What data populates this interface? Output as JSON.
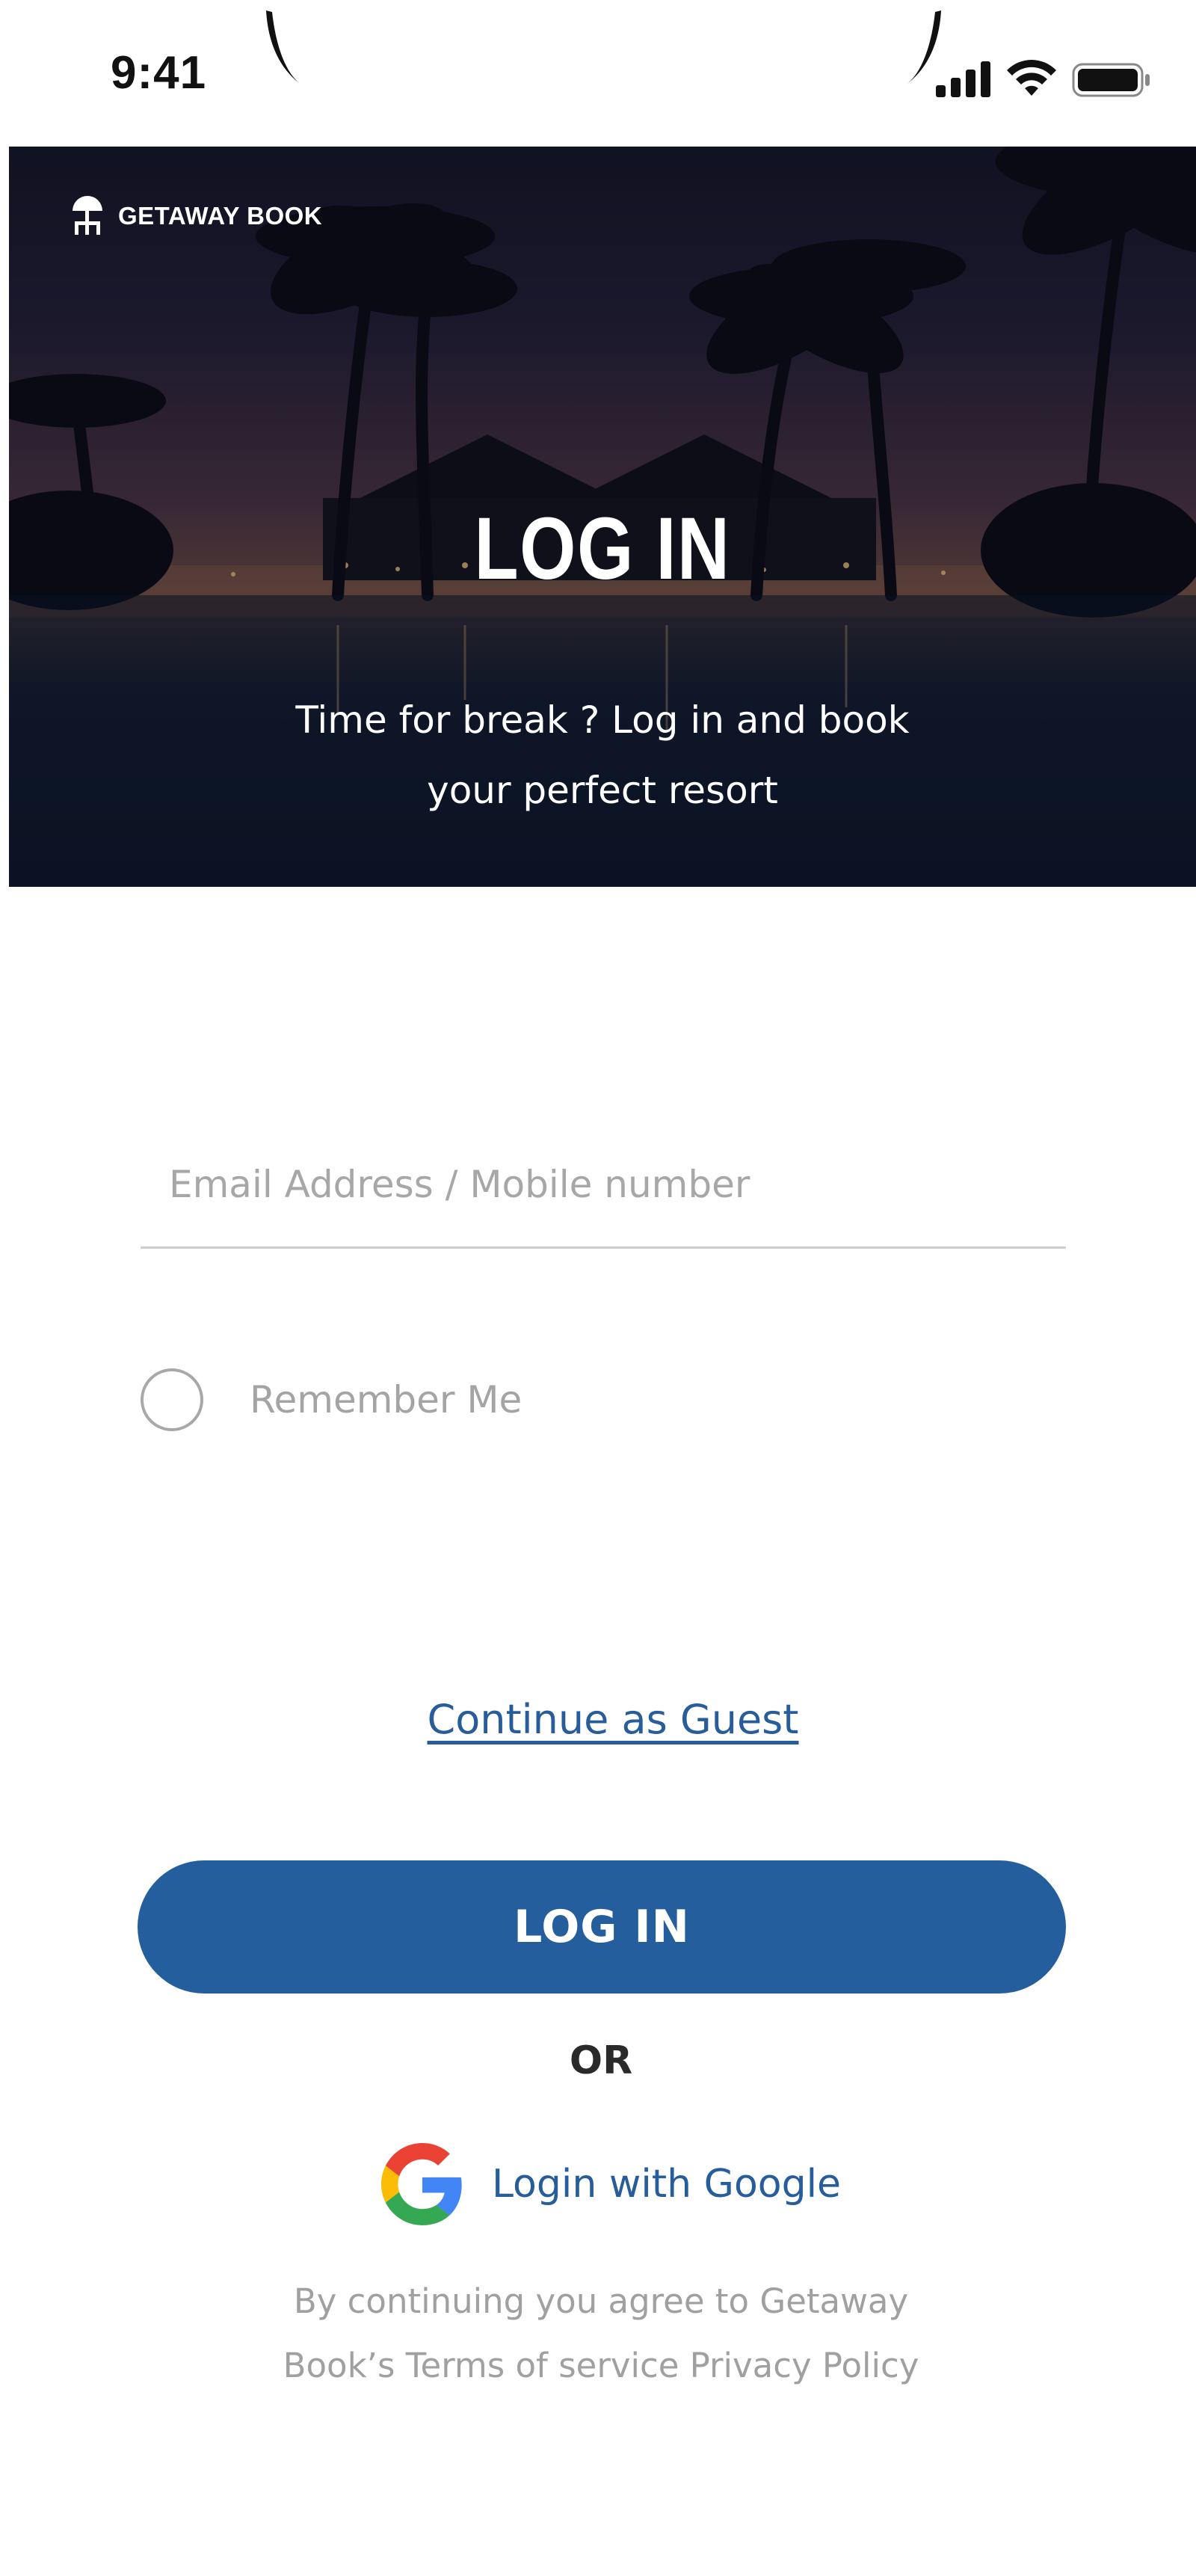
{
  "status_bar": {
    "time": "9:41",
    "icons": [
      "cellular-signal-icon",
      "wifi-icon",
      "battery-icon"
    ]
  },
  "hero": {
    "brand_name": "GETAWAY BOOK",
    "brand_icon": "beach-umbrella-icon",
    "title": "LOG IN",
    "subtitle_line1": "Time for break ? Log in and book",
    "subtitle_line2": "your perfect resort"
  },
  "form": {
    "email": {
      "value": "",
      "placeholder": "Email Address / Mobile number"
    },
    "remember_me": {
      "label": "Remember Me",
      "checked": false
    },
    "guest_link": "Continue as Guest",
    "login_button": "LOG IN",
    "or_label": "OR",
    "google_login": {
      "label": "Login with Google",
      "icon": "google-logo-icon"
    },
    "terms_line1": "By continuing  you agree to Getaway",
    "terms_line2": "Book’s Terms of service Privacy Policy"
  },
  "colors": {
    "primary": "#245e9c",
    "link": "#265d9a",
    "placeholder": "#a7a7a7",
    "muted_text": "#a0a0a0"
  }
}
